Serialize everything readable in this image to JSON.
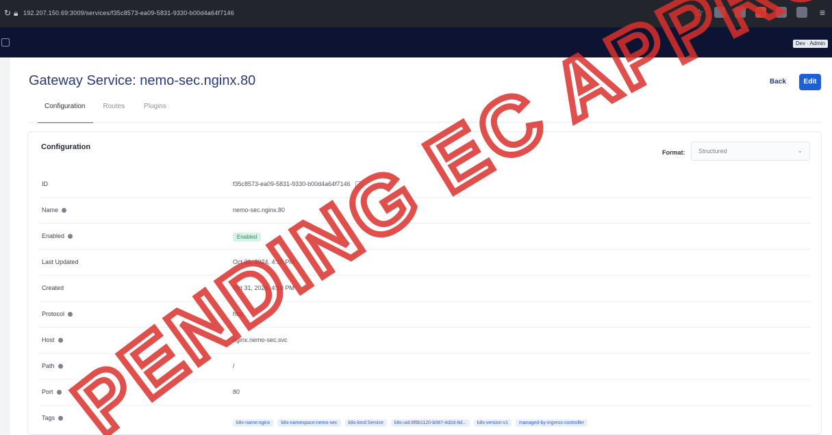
{
  "browser": {
    "url": "192.207.150.69:3009/services/f35c8573-ea09-5831-9330-b00d4a64f7146"
  },
  "header": {
    "user_chip": "Dev ∙ Admin"
  },
  "page": {
    "title": "Gateway Service: nemo-sec.nginx.80",
    "back_label": "Back",
    "edit_label": "Edit",
    "tabs": [
      {
        "label": "Configuration",
        "active": true
      },
      {
        "label": "Routes",
        "active": false
      },
      {
        "label": "Plugins",
        "active": false
      }
    ]
  },
  "config": {
    "title": "Configuration",
    "format_label": "Format:",
    "format_value": "Structured",
    "rows": [
      {
        "key": "ID",
        "value": "f35c8573-ea09-5831-9330-b00d4a64f7146",
        "info": false
      },
      {
        "key": "Name",
        "value": "nemo-sec.nginx.80",
        "info": true
      },
      {
        "key": "Enabled",
        "value": "Enabled",
        "info": true
      },
      {
        "key": "Last Updated",
        "value": "Oct 31, 2024, 4:10 PM",
        "info": false
      },
      {
        "key": "Created",
        "value": "Oct 31, 2024, 4:10 PM",
        "info": false
      },
      {
        "key": "Protocol",
        "value": "http",
        "info": true
      },
      {
        "key": "Host",
        "value": "nginx.nemo-sec.svc",
        "info": true
      },
      {
        "key": "Path",
        "value": "/",
        "info": true
      },
      {
        "key": "Port",
        "value": "80",
        "info": true
      },
      {
        "key": "Tags",
        "value": "",
        "info": true
      }
    ],
    "tags": [
      "k8s-name:nginx",
      "k8s-namespace:nemo-sec",
      "k8s-kind:Service",
      "k8s-uid:8f6b1120-b087-4d2d-8d...",
      "k8s-version:v1",
      "managed-by-ingress-controller"
    ]
  },
  "watermark": {
    "text": "PENDING EC APPROVAL",
    "color": "#d9302c"
  }
}
